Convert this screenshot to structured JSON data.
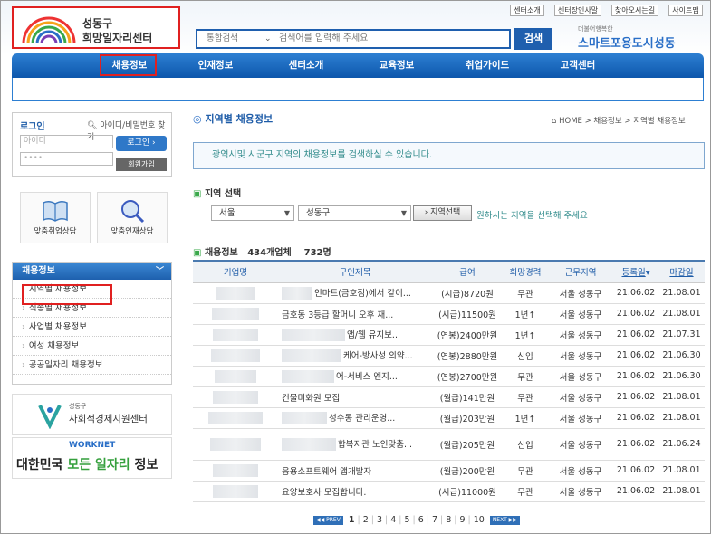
{
  "header": {
    "logo_small": "성동구",
    "logo_big": "희망일자리센터",
    "search_select": "통합검색",
    "search_placeholder": "검색어를 입력해 주세요",
    "search_button": "검색",
    "top_links": [
      "센터소개",
      "센터장인사말",
      "찾아오시는길",
      "사이트맵"
    ],
    "brand_small": "더불어행복한",
    "brand_big": "스마트포용도시성동"
  },
  "nav": {
    "items": [
      "채용정보",
      "인재정보",
      "센터소개",
      "교육정보",
      "취업가이드",
      "고객센터"
    ],
    "active": "채용정보"
  },
  "login": {
    "title": "로그인",
    "find": "아이디/비밀번호 찾기",
    "id_placeholder": "아이디",
    "pw_value": "••••",
    "login_button": "로그인",
    "join_button": "회원가입"
  },
  "quick": [
    {
      "label": "맞춤취업상담",
      "icon": "book-icon"
    },
    {
      "label": "맞춤인재상담",
      "icon": "magnifier-icon"
    }
  ],
  "side_menu": {
    "title": "채용정보",
    "items": [
      "지역별 채용정보",
      "직종별 채용정보",
      "사업별 채용정보",
      "여성 채용정보",
      "공공일자리 채용정보"
    ]
  },
  "banners": {
    "b1_small": "성동구",
    "b1_big": "사회적경제지원센터",
    "b2_logo": "WORKNET",
    "b2_a": "대한민국 ",
    "b2_b": "모든 일자리",
    "b2_c": " 정보"
  },
  "page": {
    "title": "지역별 채용정보",
    "breadcrumb": "HOME > 채용정보 > 지역별 채용정보",
    "info": "광역시및 시군구 지역의 채용정보를 검색하실 수 있습니다.",
    "region_title": "지역 선택",
    "region1": "서울",
    "region2": "성동구",
    "region_button": "지역선택",
    "region_hint": "원하시는 지역을 선택해 주세요",
    "stats_label": "채용정보",
    "stats_companies": "434개업체",
    "stats_count": "732명"
  },
  "table": {
    "headers": [
      "기업명",
      "구인제목",
      "급여",
      "희망경력",
      "근무지역",
      "등록일",
      "마감일"
    ],
    "rows": [
      {
        "title": "인마트(금호점)에서 같이...",
        "pay": "(시급)8720원",
        "career": "무관",
        "area": "서울 성동구",
        "reg": "21.06.02",
        "end": "21.08.01"
      },
      {
        "title": "금호동 3등급 할머니 오후 재...",
        "pay": "(시급)11500원",
        "career": "1년↑",
        "area": "서울 성동구",
        "reg": "21.06.02",
        "end": "21.08.01"
      },
      {
        "title": "앱/웹 유지보...",
        "pay": "(연봉)2400만원",
        "career": "1년↑",
        "area": "서울 성동구",
        "reg": "21.06.02",
        "end": "21.07.31"
      },
      {
        "title": "케어-방사성 의약...",
        "pay": "(연봉)2880만원",
        "career": "신입",
        "area": "서울 성동구",
        "reg": "21.06.02",
        "end": "21.06.30"
      },
      {
        "title": "어-서비스 엔지...",
        "pay": "(연봉)2700만원",
        "career": "무관",
        "area": "서울 성동구",
        "reg": "21.06.02",
        "end": "21.06.30"
      },
      {
        "title": "건물미화원 모집",
        "pay": "(월급)141만원",
        "career": "무관",
        "area": "서울 성동구",
        "reg": "21.06.02",
        "end": "21.08.01"
      },
      {
        "title": "성수동 관리운영...",
        "pay": "(월급)203만원",
        "career": "1년↑",
        "area": "서울 성동구",
        "reg": "21.06.02",
        "end": "21.08.01"
      },
      {
        "title": "합복지관 노인맞춤...",
        "pay": "(월급)205만원",
        "career": "신입",
        "area": "서울 성동구",
        "reg": "21.06.02",
        "end": "21.06.24"
      },
      {
        "title": "응용소프트웨어 앱개발자",
        "pay": "(월급)200만원",
        "career": "무관",
        "area": "서울 성동구",
        "reg": "21.06.02",
        "end": "21.08.01"
      },
      {
        "title": "요양보호사 모집합니다.",
        "pay": "(시급)11000원",
        "career": "무관",
        "area": "서울 성동구",
        "reg": "21.06.02",
        "end": "21.08.01"
      }
    ]
  },
  "pager": {
    "prev": "PREV",
    "next": "NEXT",
    "pages": [
      "1",
      "2",
      "3",
      "4",
      "5",
      "6",
      "7",
      "8",
      "9",
      "10"
    ]
  }
}
